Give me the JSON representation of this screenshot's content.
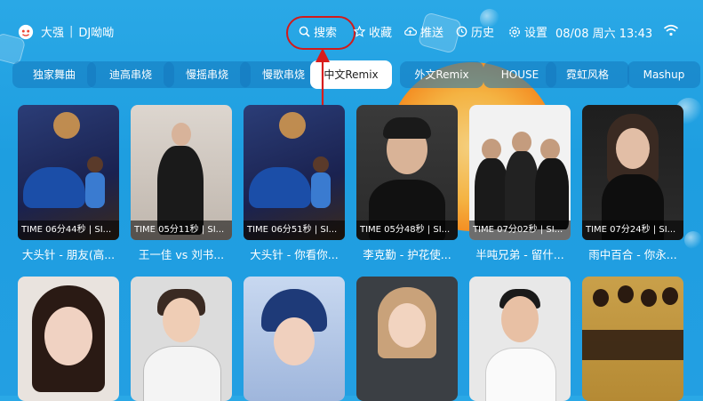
{
  "app": {
    "user_name": "大强",
    "app_name": "DJ呦呦"
  },
  "nav": {
    "search": "搜索",
    "favorites": "收藏",
    "push": "推送",
    "history": "历史",
    "settings": "设置"
  },
  "status": {
    "datetime": "08/08 周六 13:43"
  },
  "tabs": [
    {
      "label": "独家舞曲"
    },
    {
      "label": "迪高串烧"
    },
    {
      "label": "慢摇串烧"
    },
    {
      "label": "慢歌串烧"
    },
    {
      "label": "中文Remix",
      "active": true
    },
    {
      "label": "外文Remix"
    },
    {
      "label": "HOUSE"
    },
    {
      "label": "霓虹风格"
    },
    {
      "label": "Mashup"
    }
  ],
  "cards_row1": [
    {
      "time": "TIME 06分44秒 | SI...",
      "title": "大头针 - 朋友(高..."
    },
    {
      "time": "TIME 05分11秒 | SI...",
      "title": "王一佳 vs 刘书..."
    },
    {
      "time": "TIME 06分51秒 | SI...",
      "title": "大头针 - 你看你..."
    },
    {
      "time": "TIME 05分48秒 | SI...",
      "title": "李克勤 - 护花使..."
    },
    {
      "time": "TIME 07分02秒 | SI...",
      "title": "半吨兄弟 - 留什..."
    },
    {
      "time": "TIME 07分24秒 | SI...",
      "title": "雨中百合 - 你永..."
    }
  ],
  "colors": {
    "accent_ring": "#d21a1a",
    "background": "#239fe2",
    "tab_bg": "#1478be"
  }
}
